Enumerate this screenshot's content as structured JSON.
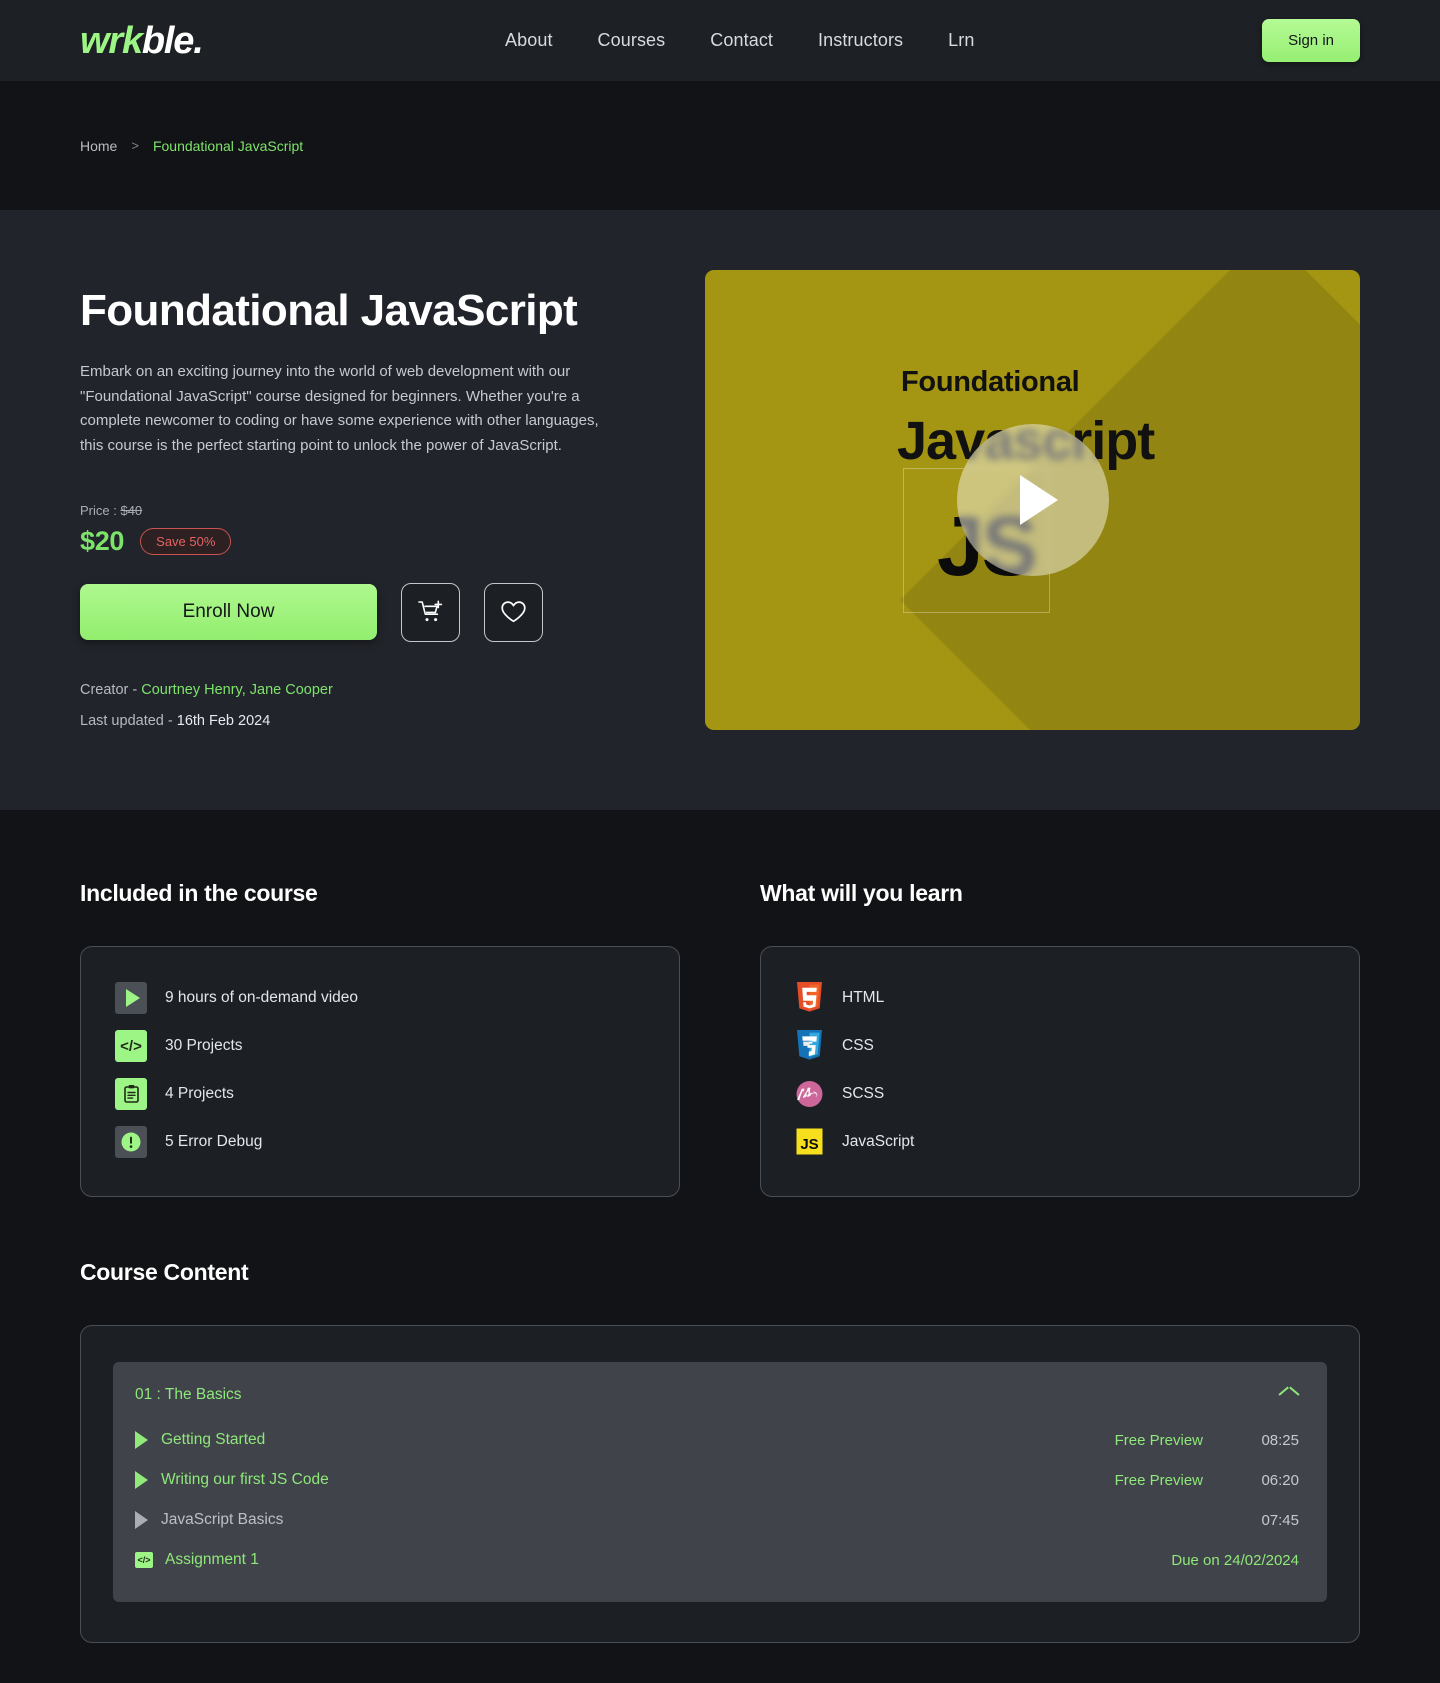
{
  "header": {
    "logo_green": "wrk",
    "logo_white": "ble.",
    "nav": [
      {
        "label": "About"
      },
      {
        "label": "Courses"
      },
      {
        "label": "Contact"
      },
      {
        "label": "Instructors"
      },
      {
        "label": "Lrn"
      }
    ],
    "signin_label": "Sign in",
    "accent_green": "#9df585"
  },
  "breadcrumb": {
    "home": "Home",
    "separator": ">",
    "current": "Foundational JavaScript"
  },
  "hero": {
    "title": "Foundational JavaScript",
    "description": "Embark on an exciting journey into the world of web development with our \"Foundational JavaScript\" course designed for beginners. Whether you're a complete newcomer to coding or have some experience with other languages, this course is the perfect starting point to unlock the power of JavaScript.",
    "price_label": "Price : ",
    "price_original": "$40",
    "price_current": "$20",
    "save_badge": "Save 50%",
    "enroll_label": "Enroll Now",
    "cart_icon": "cart-plus-icon",
    "wishlist_icon": "heart-icon",
    "creator_label": "Creator - ",
    "creator_names": "Courtney Henry, Jane Cooper",
    "updated_label": "Last updated - ",
    "updated_date": "16th Feb 2024",
    "thumbnail": {
      "line1": "Foundational",
      "line2": "Javascript",
      "badge": "JS",
      "play_icon": "play-icon",
      "bg_color": "#a49513"
    }
  },
  "included": {
    "title": "Included in the course",
    "items": [
      {
        "label": "9 hours of on-demand video",
        "icon": "video-play-icon"
      },
      {
        "label": "30 Projects",
        "icon": "code-icon"
      },
      {
        "label": "4 Projects",
        "icon": "clipboard-icon"
      },
      {
        "label": "5 Error Debug",
        "icon": "alert-icon"
      }
    ]
  },
  "learn": {
    "title": "What will you learn",
    "items": [
      {
        "label": "HTML",
        "icon": "html5-icon"
      },
      {
        "label": "CSS",
        "icon": "css3-icon"
      },
      {
        "label": "SCSS",
        "icon": "sass-icon"
      },
      {
        "label": "JavaScript",
        "icon": "javascript-icon"
      }
    ]
  },
  "course_content": {
    "title": "Course Content",
    "modules": [
      {
        "heading": "01 : The Basics",
        "expanded": true,
        "collapse_icon": "chevron-up-icon",
        "lessons": [
          {
            "name": "Getting Started",
            "type": "video",
            "free": "Free Preview",
            "duration": "08:25",
            "active": true
          },
          {
            "name": "Writing our first JS Code",
            "type": "video",
            "free": "Free Preview",
            "duration": "06:20",
            "active": true
          },
          {
            "name": "JavaScript Basics",
            "type": "video",
            "free": "",
            "duration": "07:45",
            "active": false
          },
          {
            "name": "Assignment 1",
            "type": "assignment",
            "due": "Due on 24/02/2024",
            "active": true
          }
        ]
      }
    ]
  }
}
